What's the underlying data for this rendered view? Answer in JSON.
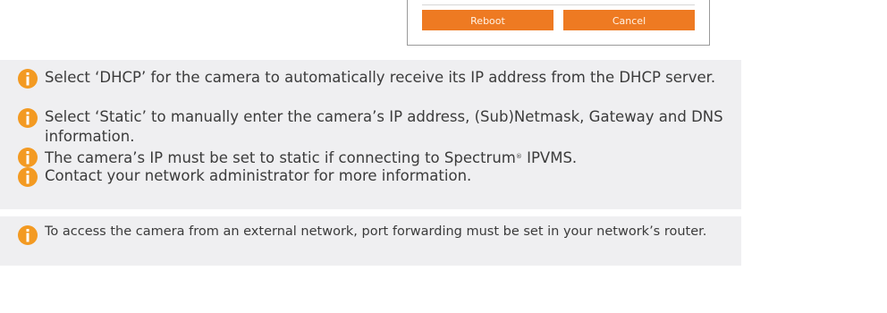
{
  "dialog": {
    "reboot_label": "Reboot",
    "cancel_label": "Cancel"
  },
  "notes": [
    "Select ‘DHCP’ for the camera to automatically receive its IP address from the DHCP server.",
    "Select ‘Static’ to manually enter the camera’s IP address, (Sub)Netmask, Gateway and DNS information.",
    "Contact your network administrator for more information."
  ],
  "note_spectrum": {
    "before": "The camera’s IP must be set to static if connecting to Spectrum",
    "reg": "®",
    "after": " IPVMS."
  },
  "tip": "To access the camera from an external network, port forwarding must be set in your network’s router.",
  "icon": "info-icon",
  "colors": {
    "accent_orange": "#ee7a22",
    "info_icon": "#f39a22",
    "note_background": "#efeff1"
  }
}
